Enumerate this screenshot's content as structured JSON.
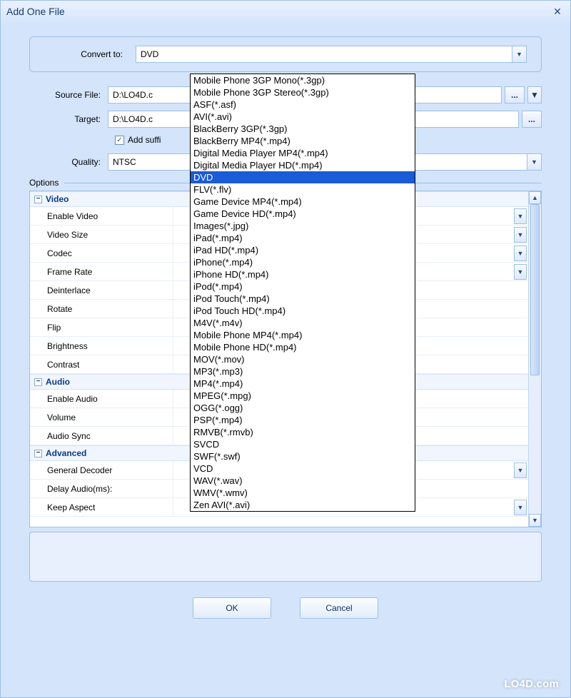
{
  "title": "Add One File",
  "convert": {
    "label": "Convert to:",
    "value": "DVD"
  },
  "source": {
    "label": "Source File:",
    "value": "D:\\LO4D.c"
  },
  "target": {
    "label": "Target:",
    "value": "D:\\LO4D.c"
  },
  "suffix": {
    "label": "Add suffi",
    "checked": true
  },
  "quality": {
    "label": "Quality:",
    "value": "NTSC"
  },
  "options_label": "Options",
  "groups": [
    {
      "name": "Video",
      "props": [
        "Enable Video",
        "Video Size",
        "Codec",
        "Frame Rate",
        "Deinterlace",
        "Rotate",
        "Flip",
        "Brightness",
        "Contrast"
      ]
    },
    {
      "name": "Audio",
      "props": [
        "Enable Audio",
        "Volume",
        "Audio Sync"
      ]
    },
    {
      "name": "Advanced",
      "props": [
        "General Decoder",
        "Delay Audio(ms):",
        "Keep Aspect"
      ]
    }
  ],
  "no_arrow_props": [
    "Deinterlace",
    "Rotate",
    "Flip",
    "Brightness",
    "Contrast",
    "Enable Audio",
    "Volume",
    "Audio Sync",
    "Delay Audio(ms):"
  ],
  "buttons": {
    "ok": "OK",
    "cancel": "Cancel"
  },
  "watermark": "LO4D.com",
  "dropdown_options": [
    "Mobile Phone 3GP Mono(*.3gp)",
    "Mobile Phone 3GP Stereo(*.3gp)",
    "ASF(*.asf)",
    "AVI(*.avi)",
    "BlackBerry 3GP(*.3gp)",
    "BlackBerry MP4(*.mp4)",
    "Digital Media Player MP4(*.mp4)",
    "Digital Media Player HD(*.mp4)",
    "DVD",
    "FLV(*.flv)",
    "Game Device MP4(*.mp4)",
    "Game Device HD(*.mp4)",
    "Images(*.jpg)",
    "iPad(*.mp4)",
    "iPad HD(*.mp4)",
    "iPhone(*.mp4)",
    "iPhone HD(*.mp4)",
    "iPod(*.mp4)",
    "iPod Touch(*.mp4)",
    "iPod Touch HD(*.mp4)",
    "M4V(*.m4v)",
    "Mobile Phone MP4(*.mp4)",
    "Mobile Phone HD(*.mp4)",
    "MOV(*.mov)",
    "MP3(*.mp3)",
    "MP4(*.mp4)",
    "MPEG(*.mpg)",
    "OGG(*.ogg)",
    "PSP(*.mp4)",
    "RMVB(*.rmvb)",
    "SVCD",
    "SWF(*.swf)",
    "VCD",
    "WAV(*.wav)",
    "WMV(*.wmv)",
    "Zen AVI(*.avi)"
  ],
  "dropdown_selected": "DVD"
}
